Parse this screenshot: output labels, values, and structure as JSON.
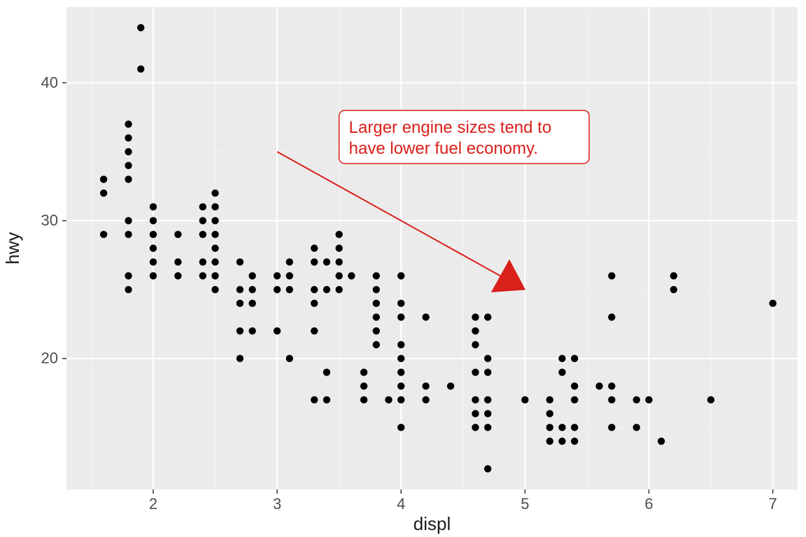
{
  "chart_data": {
    "type": "scatter",
    "xlabel": "displ",
    "ylabel": "hwy",
    "xlim": [
      1.3,
      7.2
    ],
    "ylim": [
      10.5,
      45.5
    ],
    "x_breaks": [
      2,
      3,
      4,
      5,
      6,
      7
    ],
    "y_breaks": [
      20,
      30,
      40
    ],
    "x_minor": [
      1.5,
      2.5,
      3.5,
      4.5,
      5.5,
      6.5
    ],
    "y_minor": [
      15,
      25,
      35,
      45
    ],
    "annotation": {
      "line1": "Larger engine sizes tend to",
      "line2": "have lower fuel economy.",
      "label_box": {
        "x_data": 3.5,
        "y_data": 38
      },
      "arrow_from": {
        "x_data": 3.0,
        "y_data": 35
      },
      "arrow_to": {
        "x_data": 5.0,
        "y_data": 25
      },
      "color": "#d9201a"
    },
    "points": [
      {
        "x": 1.8,
        "y": 29
      },
      {
        "x": 1.8,
        "y": 29
      },
      {
        "x": 2.0,
        "y": 31
      },
      {
        "x": 2.0,
        "y": 30
      },
      {
        "x": 2.8,
        "y": 26
      },
      {
        "x": 2.8,
        "y": 26
      },
      {
        "x": 3.1,
        "y": 27
      },
      {
        "x": 1.8,
        "y": 26
      },
      {
        "x": 1.8,
        "y": 25
      },
      {
        "x": 2.0,
        "y": 28
      },
      {
        "x": 2.0,
        "y": 27
      },
      {
        "x": 2.8,
        "y": 25
      },
      {
        "x": 2.8,
        "y": 25
      },
      {
        "x": 3.1,
        "y": 25
      },
      {
        "x": 3.1,
        "y": 25
      },
      {
        "x": 2.8,
        "y": 24
      },
      {
        "x": 3.1,
        "y": 25
      },
      {
        "x": 4.2,
        "y": 23
      },
      {
        "x": 5.3,
        "y": 20
      },
      {
        "x": 5.3,
        "y": 15
      },
      {
        "x": 5.3,
        "y": 20
      },
      {
        "x": 5.7,
        "y": 17
      },
      {
        "x": 6.0,
        "y": 17
      },
      {
        "x": 5.7,
        "y": 26
      },
      {
        "x": 5.7,
        "y": 23
      },
      {
        "x": 6.2,
        "y": 26
      },
      {
        "x": 6.2,
        "y": 25
      },
      {
        "x": 7.0,
        "y": 24
      },
      {
        "x": 5.3,
        "y": 19
      },
      {
        "x": 5.3,
        "y": 14
      },
      {
        "x": 5.7,
        "y": 15
      },
      {
        "x": 6.5,
        "y": 17
      },
      {
        "x": 2.4,
        "y": 27
      },
      {
        "x": 2.4,
        "y": 30
      },
      {
        "x": 3.1,
        "y": 26
      },
      {
        "x": 3.5,
        "y": 29
      },
      {
        "x": 3.6,
        "y": 26
      },
      {
        "x": 2.4,
        "y": 26
      },
      {
        "x": 3.0,
        "y": 22
      },
      {
        "x": 3.3,
        "y": 22
      },
      {
        "x": 3.3,
        "y": 24
      },
      {
        "x": 3.3,
        "y": 24
      },
      {
        "x": 3.3,
        "y": 24
      },
      {
        "x": 3.3,
        "y": 17
      },
      {
        "x": 3.8,
        "y": 22
      },
      {
        "x": 3.8,
        "y": 21
      },
      {
        "x": 3.8,
        "y": 23
      },
      {
        "x": 4.0,
        "y": 23
      },
      {
        "x": 3.7,
        "y": 19
      },
      {
        "x": 3.7,
        "y": 18
      },
      {
        "x": 3.9,
        "y": 17
      },
      {
        "x": 3.9,
        "y": 17
      },
      {
        "x": 4.7,
        "y": 19
      },
      {
        "x": 4.7,
        "y": 19
      },
      {
        "x": 4.7,
        "y": 12
      },
      {
        "x": 5.2,
        "y": 17
      },
      {
        "x": 5.2,
        "y": 15
      },
      {
        "x": 3.9,
        "y": 17
      },
      {
        "x": 4.7,
        "y": 17
      },
      {
        "x": 4.7,
        "y": 12
      },
      {
        "x": 4.7,
        "y": 17
      },
      {
        "x": 5.2,
        "y": 16
      },
      {
        "x": 5.7,
        "y": 18
      },
      {
        "x": 5.9,
        "y": 17
      },
      {
        "x": 4.7,
        "y": 17
      },
      {
        "x": 4.7,
        "y": 17
      },
      {
        "x": 4.7,
        "y": 16
      },
      {
        "x": 4.7,
        "y": 12
      },
      {
        "x": 4.7,
        "y": 15
      },
      {
        "x": 4.7,
        "y": 16
      },
      {
        "x": 4.7,
        "y": 17
      },
      {
        "x": 5.2,
        "y": 14
      },
      {
        "x": 5.2,
        "y": 17
      },
      {
        "x": 5.7,
        "y": 17
      },
      {
        "x": 5.9,
        "y": 15
      },
      {
        "x": 4.6,
        "y": 16
      },
      {
        "x": 5.4,
        "y": 18
      },
      {
        "x": 5.4,
        "y": 18
      },
      {
        "x": 4.0,
        "y": 17
      },
      {
        "x": 4.0,
        "y": 19
      },
      {
        "x": 4.0,
        "y": 17
      },
      {
        "x": 4.0,
        "y": 19
      },
      {
        "x": 4.6,
        "y": 19
      },
      {
        "x": 5.0,
        "y": 17
      },
      {
        "x": 4.2,
        "y": 17
      },
      {
        "x": 4.2,
        "y": 17
      },
      {
        "x": 4.6,
        "y": 16
      },
      {
        "x": 4.6,
        "y": 16
      },
      {
        "x": 4.6,
        "y": 17
      },
      {
        "x": 5.4,
        "y": 17
      },
      {
        "x": 5.4,
        "y": 18
      },
      {
        "x": 4.0,
        "y": 15
      },
      {
        "x": 4.0,
        "y": 18
      },
      {
        "x": 4.6,
        "y": 17
      },
      {
        "x": 5.0,
        "y": 17
      },
      {
        "x": 3.8,
        "y": 26
      },
      {
        "x": 3.8,
        "y": 25
      },
      {
        "x": 4.0,
        "y": 26
      },
      {
        "x": 4.0,
        "y": 24
      },
      {
        "x": 4.6,
        "y": 21
      },
      {
        "x": 4.6,
        "y": 22
      },
      {
        "x": 4.6,
        "y": 23
      },
      {
        "x": 4.6,
        "y": 22
      },
      {
        "x": 5.4,
        "y": 20
      },
      {
        "x": 1.6,
        "y": 33
      },
      {
        "x": 1.6,
        "y": 32
      },
      {
        "x": 1.6,
        "y": 32
      },
      {
        "x": 1.6,
        "y": 29
      },
      {
        "x": 1.6,
        "y": 32
      },
      {
        "x": 1.8,
        "y": 34
      },
      {
        "x": 1.8,
        "y": 36
      },
      {
        "x": 1.8,
        "y": 36
      },
      {
        "x": 2.0,
        "y": 29
      },
      {
        "x": 2.4,
        "y": 26
      },
      {
        "x": 2.4,
        "y": 27
      },
      {
        "x": 2.4,
        "y": 30
      },
      {
        "x": 2.4,
        "y": 31
      },
      {
        "x": 2.5,
        "y": 26
      },
      {
        "x": 2.5,
        "y": 26
      },
      {
        "x": 3.3,
        "y": 28
      },
      {
        "x": 2.0,
        "y": 26
      },
      {
        "x": 2.0,
        "y": 29
      },
      {
        "x": 2.0,
        "y": 28
      },
      {
        "x": 2.0,
        "y": 27
      },
      {
        "x": 2.7,
        "y": 24
      },
      {
        "x": 2.7,
        "y": 24
      },
      {
        "x": 2.7,
        "y": 24
      },
      {
        "x": 3.0,
        "y": 22
      },
      {
        "x": 3.7,
        "y": 17
      },
      {
        "x": 4.0,
        "y": 20
      },
      {
        "x": 4.7,
        "y": 17
      },
      {
        "x": 4.7,
        "y": 15
      },
      {
        "x": 4.7,
        "y": 20
      },
      {
        "x": 5.7,
        "y": 15
      },
      {
        "x": 6.1,
        "y": 14
      },
      {
        "x": 4.0,
        "y": 15
      },
      {
        "x": 4.2,
        "y": 18
      },
      {
        "x": 4.4,
        "y": 18
      },
      {
        "x": 4.6,
        "y": 15
      },
      {
        "x": 5.4,
        "y": 15
      },
      {
        "x": 5.4,
        "y": 14
      },
      {
        "x": 5.4,
        "y": 14
      },
      {
        "x": 4.0,
        "y": 21
      },
      {
        "x": 4.0,
        "y": 19
      },
      {
        "x": 4.6,
        "y": 17
      },
      {
        "x": 5.0,
        "y": 17
      },
      {
        "x": 2.4,
        "y": 29
      },
      {
        "x": 2.4,
        "y": 27
      },
      {
        "x": 2.5,
        "y": 31
      },
      {
        "x": 2.5,
        "y": 32
      },
      {
        "x": 3.5,
        "y": 27
      },
      {
        "x": 3.5,
        "y": 26
      },
      {
        "x": 3.0,
        "y": 26
      },
      {
        "x": 3.0,
        "y": 25
      },
      {
        "x": 3.5,
        "y": 25
      },
      {
        "x": 3.3,
        "y": 27
      },
      {
        "x": 3.3,
        "y": 25
      },
      {
        "x": 4.0,
        "y": 20
      },
      {
        "x": 5.6,
        "y": 18
      },
      {
        "x": 3.1,
        "y": 20
      },
      {
        "x": 3.8,
        "y": 24
      },
      {
        "x": 3.8,
        "y": 25
      },
      {
        "x": 3.8,
        "y": 23
      },
      {
        "x": 5.3,
        "y": 20
      },
      {
        "x": 2.5,
        "y": 29
      },
      {
        "x": 2.5,
        "y": 27
      },
      {
        "x": 2.5,
        "y": 31
      },
      {
        "x": 2.5,
        "y": 30
      },
      {
        "x": 2.5,
        "y": 26
      },
      {
        "x": 2.5,
        "y": 26
      },
      {
        "x": 2.2,
        "y": 29
      },
      {
        "x": 2.2,
        "y": 27
      },
      {
        "x": 2.5,
        "y": 25
      },
      {
        "x": 2.5,
        "y": 28
      },
      {
        "x": 2.5,
        "y": 25
      },
      {
        "x": 2.5,
        "y": 29
      },
      {
        "x": 2.5,
        "y": 27
      },
      {
        "x": 2.7,
        "y": 25
      },
      {
        "x": 2.7,
        "y": 27
      },
      {
        "x": 3.4,
        "y": 27
      },
      {
        "x": 3.4,
        "y": 25
      },
      {
        "x": 4.0,
        "y": 26
      },
      {
        "x": 4.7,
        "y": 23
      },
      {
        "x": 2.2,
        "y": 26
      },
      {
        "x": 2.2,
        "y": 26
      },
      {
        "x": 2.4,
        "y": 27
      },
      {
        "x": 2.4,
        "y": 29
      },
      {
        "x": 3.0,
        "y": 26
      },
      {
        "x": 3.0,
        "y": 26
      },
      {
        "x": 3.5,
        "y": 28
      },
      {
        "x": 2.2,
        "y": 27
      },
      {
        "x": 2.2,
        "y": 29
      },
      {
        "x": 2.4,
        "y": 31
      },
      {
        "x": 2.4,
        "y": 31
      },
      {
        "x": 3.0,
        "y": 26
      },
      {
        "x": 3.0,
        "y": 26
      },
      {
        "x": 3.3,
        "y": 27
      },
      {
        "x": 1.8,
        "y": 30
      },
      {
        "x": 1.8,
        "y": 33
      },
      {
        "x": 1.8,
        "y": 35
      },
      {
        "x": 1.8,
        "y": 37
      },
      {
        "x": 1.8,
        "y": 35
      },
      {
        "x": 4.7,
        "y": 17
      },
      {
        "x": 5.7,
        "y": 17
      },
      {
        "x": 2.7,
        "y": 20
      },
      {
        "x": 2.7,
        "y": 20
      },
      {
        "x": 2.7,
        "y": 22
      },
      {
        "x": 3.4,
        "y": 17
      },
      {
        "x": 3.4,
        "y": 19
      },
      {
        "x": 4.0,
        "y": 18
      },
      {
        "x": 4.0,
        "y": 20
      },
      {
        "x": 2.0,
        "y": 26
      },
      {
        "x": 2.0,
        "y": 26
      },
      {
        "x": 2.0,
        "y": 27
      },
      {
        "x": 2.0,
        "y": 26
      },
      {
        "x": 2.8,
        "y": 24
      },
      {
        "x": 1.9,
        "y": 44
      },
      {
        "x": 2.0,
        "y": 29
      },
      {
        "x": 2.0,
        "y": 29
      },
      {
        "x": 2.0,
        "y": 29
      },
      {
        "x": 2.0,
        "y": 29
      },
      {
        "x": 2.8,
        "y": 24
      },
      {
        "x": 2.8,
        "y": 24
      },
      {
        "x": 2.8,
        "y": 24
      },
      {
        "x": 2.8,
        "y": 22
      },
      {
        "x": 1.9,
        "y": 41
      },
      {
        "x": 1.9,
        "y": 44
      },
      {
        "x": 2.0,
        "y": 29
      },
      {
        "x": 2.0,
        "y": 26
      },
      {
        "x": 2.5,
        "y": 29
      },
      {
        "x": 2.5,
        "y": 29
      },
      {
        "x": 1.8,
        "y": 29
      },
      {
        "x": 1.8,
        "y": 29
      },
      {
        "x": 2.0,
        "y": 28
      },
      {
        "x": 2.0,
        "y": 29
      },
      {
        "x": 2.8,
        "y": 26
      },
      {
        "x": 2.8,
        "y": 26
      },
      {
        "x": 3.6,
        "y": 26
      }
    ]
  }
}
